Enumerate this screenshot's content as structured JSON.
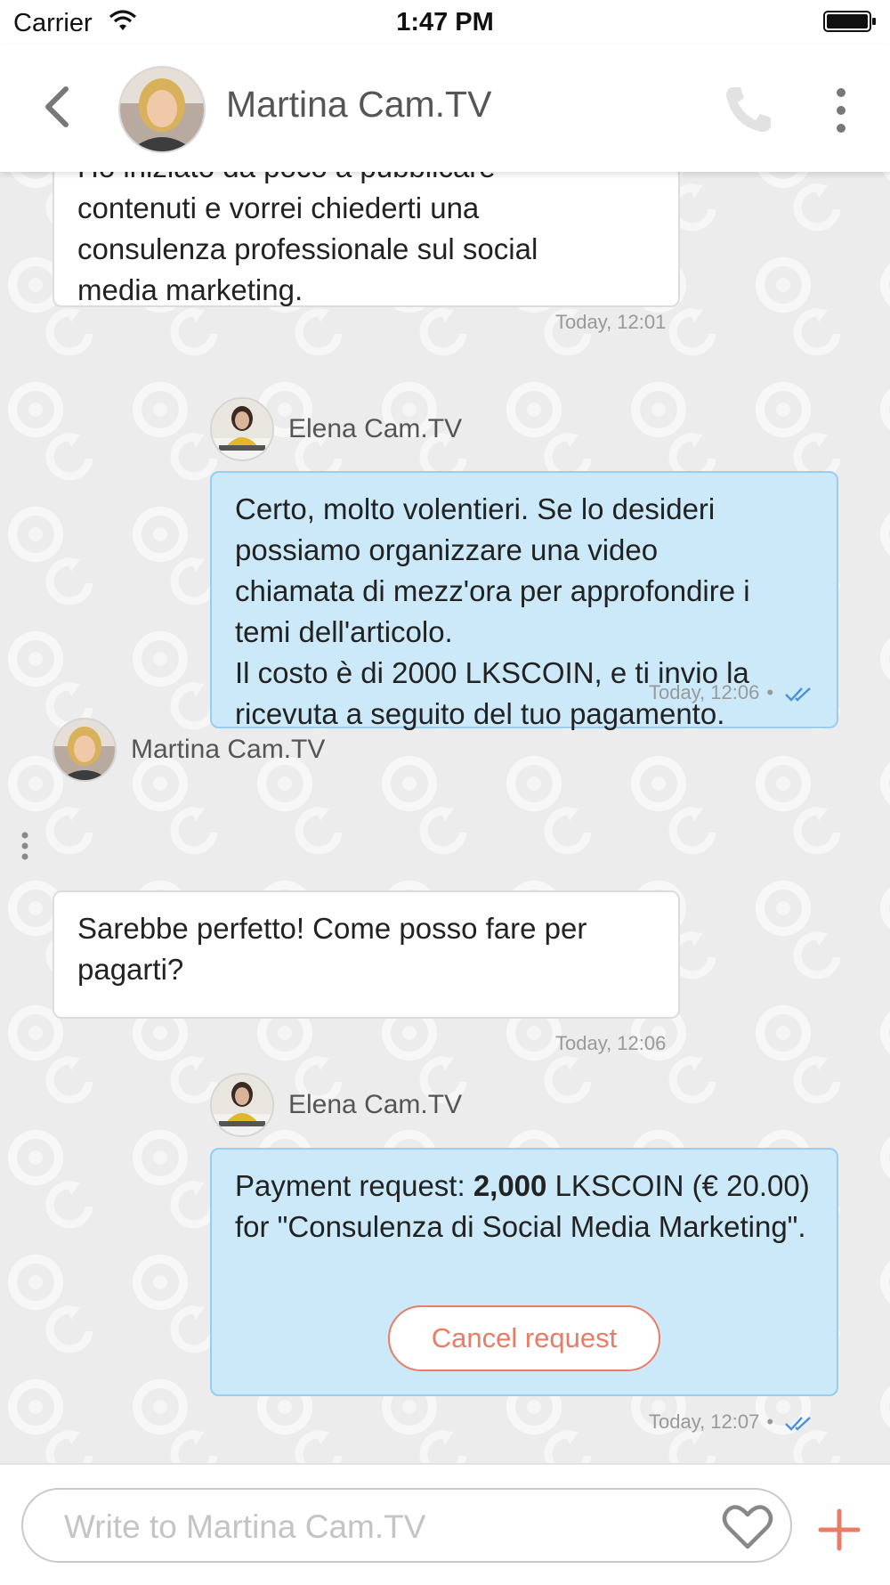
{
  "status_bar": {
    "carrier": "Carrier",
    "time": "1:47 PM"
  },
  "header": {
    "title": "Martina Cam.TV"
  },
  "messages": [
    {
      "direction": "incoming",
      "text": "Ho iniziato da poco a pubblicare\ncontenuti e vorrei chiederti una\nconsulenza professionale sul social\nmedia marketing.",
      "timestamp": "Today, 12:01"
    },
    {
      "direction": "outgoing",
      "sender": "Elena Cam.TV",
      "text": "Certo, molto volentieri. Se lo desideri\npossiamo organizzare una video\nchiamata di mezz'ora per approfondire i\ntemi dell'articolo.\nIl costo è di 2000 LKSCOIN, e ti invio la\nricevuta a seguito del tuo pagamento.",
      "timestamp": "Today, 12:06",
      "read_icon": "double-check-icon"
    },
    {
      "direction": "incoming",
      "sender": "Martina Cam.TV",
      "text": "Sarebbe perfetto! Come posso fare per\npagarti?",
      "timestamp": "Today, 12:06"
    },
    {
      "direction": "outgoing",
      "sender": "Elena Cam.TV",
      "payment": {
        "prefix": "Payment request: ",
        "amount": "2,000",
        "suffix": " LKSCOIN (€ 20.00) for \"Consulenza di Social Media Marketing\".",
        "cancel_label": "Cancel request"
      },
      "timestamp": "Today, 12:07",
      "read_icon": "double-check-icon"
    }
  ],
  "composer": {
    "placeholder": "Write to Martina Cam.TV",
    "heart_icon": "heart-icon",
    "plus_icon": "plus-icon"
  },
  "colors": {
    "accent": "#e97c66",
    "outgoing_bubble": "#cbe9f9",
    "incoming_bubble": "#ffffff",
    "read_check": "#4a90d9"
  }
}
